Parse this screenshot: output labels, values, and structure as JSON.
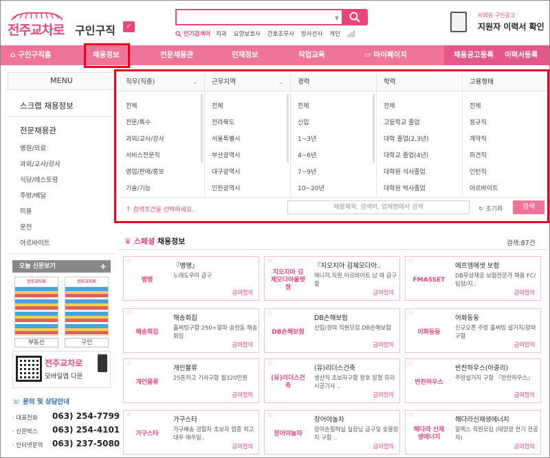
{
  "header": {
    "brand": "전주교차로",
    "sub": "구인구직",
    "search_placeholder": "",
    "popular_label": "인기검색어",
    "popular_keywords": [
      "치과",
      "요양보호사",
      "간호조무사",
      "방사선사",
      "개인"
    ],
    "resume_small": "비회원 구인광고",
    "resume_big": "지원자 이력서 확인"
  },
  "nav": {
    "home": "구인구직홈",
    "items": [
      "채용정보",
      "전문채용관",
      "인재정보",
      "직업교육",
      "마이페이지"
    ],
    "right": [
      "채용공고등록",
      "이력서등록"
    ]
  },
  "sidebar": {
    "menu_title": "MENU",
    "scrap": "스크랩 채용정보",
    "pro_title": "전문채용관",
    "pro_items": [
      "병원/의료",
      "과외/교사/강사",
      "식당/레스토랑",
      "주방/배달",
      "미용",
      "운전",
      "아르바이트"
    ],
    "news_title": "오늘 신문보기",
    "news_plus": "+",
    "news_labels": [
      "부동산",
      "구인"
    ],
    "app_title": "전주교차로",
    "app_sub": "모바일앱 다운",
    "contact_title": "문의 및 상담안내",
    "contacts": [
      {
        "label": "대표전화",
        "number": "063) 254-7799"
      },
      {
        "label": "신문박스",
        "number": "063) 254-4101"
      },
      {
        "label": "인터넷문의",
        "number": "063) 237-5080"
      }
    ]
  },
  "filter": {
    "columns": [
      {
        "title": "직무(직종)",
        "dropdown": true,
        "options": [
          "전체",
          "전문/특수",
          "과외/교사/강사",
          "서비스전문직",
          "영업/판매/홍보",
          "기술/기능"
        ]
      },
      {
        "title": "근무지역",
        "dropdown": true,
        "options": [
          "전체",
          "전라북도",
          "서울특별시",
          "부산광역시",
          "대구광역시",
          "인천광역시"
        ]
      },
      {
        "title": "경력",
        "dropdown": false,
        "options": [
          "전체",
          "신입",
          "1~3년",
          "4~6년",
          "7~9년",
          "10~20년"
        ]
      },
      {
        "title": "학력",
        "dropdown": false,
        "options": [
          "전체",
          "고등학교 졸업",
          "대학 졸업(2,3년)",
          "대학교 졸업(4년)",
          "대학원 석사졸업",
          "대학원 박사졸업"
        ]
      },
      {
        "title": "고용형태",
        "dropdown": false,
        "options": [
          "전체",
          "정규직",
          "계약직",
          "파견직",
          "인턴직",
          "아르바이트"
        ]
      }
    ],
    "hint": "↑ 검색조건을 선택하세요.",
    "keyword_placeholder": "채용제목, 검색어, 업체명에서 검색",
    "reset": "초기화",
    "search": "검색"
  },
  "special": {
    "title_pink": "스페셜",
    "title_rest": "채용정보",
    "count": "검색:87건",
    "cards": [
      {
        "logo": "뱅뱅",
        "title": "『뱅뱅』",
        "desc": "노래도우미 급구",
        "pay": "급여협의"
      },
      {
        "logo": "지오지아 김제모다아울렛점",
        "title": "『지오지아 김제모다아..",
        "desc": "매니저,직원,아르바이트 남 여 급구함",
        "pay": "급여협의"
      },
      {
        "logo": "FMASSET",
        "title": "에프엠에셋 보험",
        "desc": "DB무상제공 보험전문가 채용 FC/팀장/지..",
        "pay": "급여협의"
      },
      {
        "logo": "해송회집",
        "title": "해송회집",
        "desc": "홀써빙구함 250+알파 송천동 해송회집",
        "pay": "급여협의"
      },
      {
        "logo": "DB손해보험",
        "title": "DB손해보험",
        "desc": "신입/경력 직원모집 DB손해보험",
        "pay": "급여협의"
      },
      {
        "logo": "어화둥둥",
        "title": "어화둥둥",
        "desc": "신규오픈 주방 홀써빙 설거지/알바 구함",
        "pay": "급여협의"
      },
      {
        "logo": "개인물류",
        "title": "개인물류",
        "desc": "25톤카고 기사구함 월320만원",
        "pay": "급여협의"
      },
      {
        "logo": "(유)리더스건축",
        "title": "(유)리더스건축",
        "desc": "생산직 초보자구함 창호 잡철 유리시공기사 ..",
        "pay": "급여협의"
      },
      {
        "logo": "반찬하우스",
        "title": "반찬하우스(아중리)",
        "desc": "주방설거지 구함 『반찬하우스』",
        "pay": "급여협의"
      },
      {
        "logo": "가구스타",
        "title": "가구스타",
        "desc": "가구배송 경험자 초보자 업종 최고대우 매주일..",
        "pay": "급여협의"
      },
      {
        "logo": "장어야놀자",
        "title": "장어야놀자",
        "desc": "장어손질하실 실장님 급구및 숯불장치 구함 ..",
        "pay": "급여협의"
      },
      {
        "logo": "해다라 신재생에너지",
        "title": "해다라신재생에너지",
        "desc": "알렉스 직원모집 (태양광 전기 전공자)",
        "pay": "급여협의"
      }
    ]
  }
}
